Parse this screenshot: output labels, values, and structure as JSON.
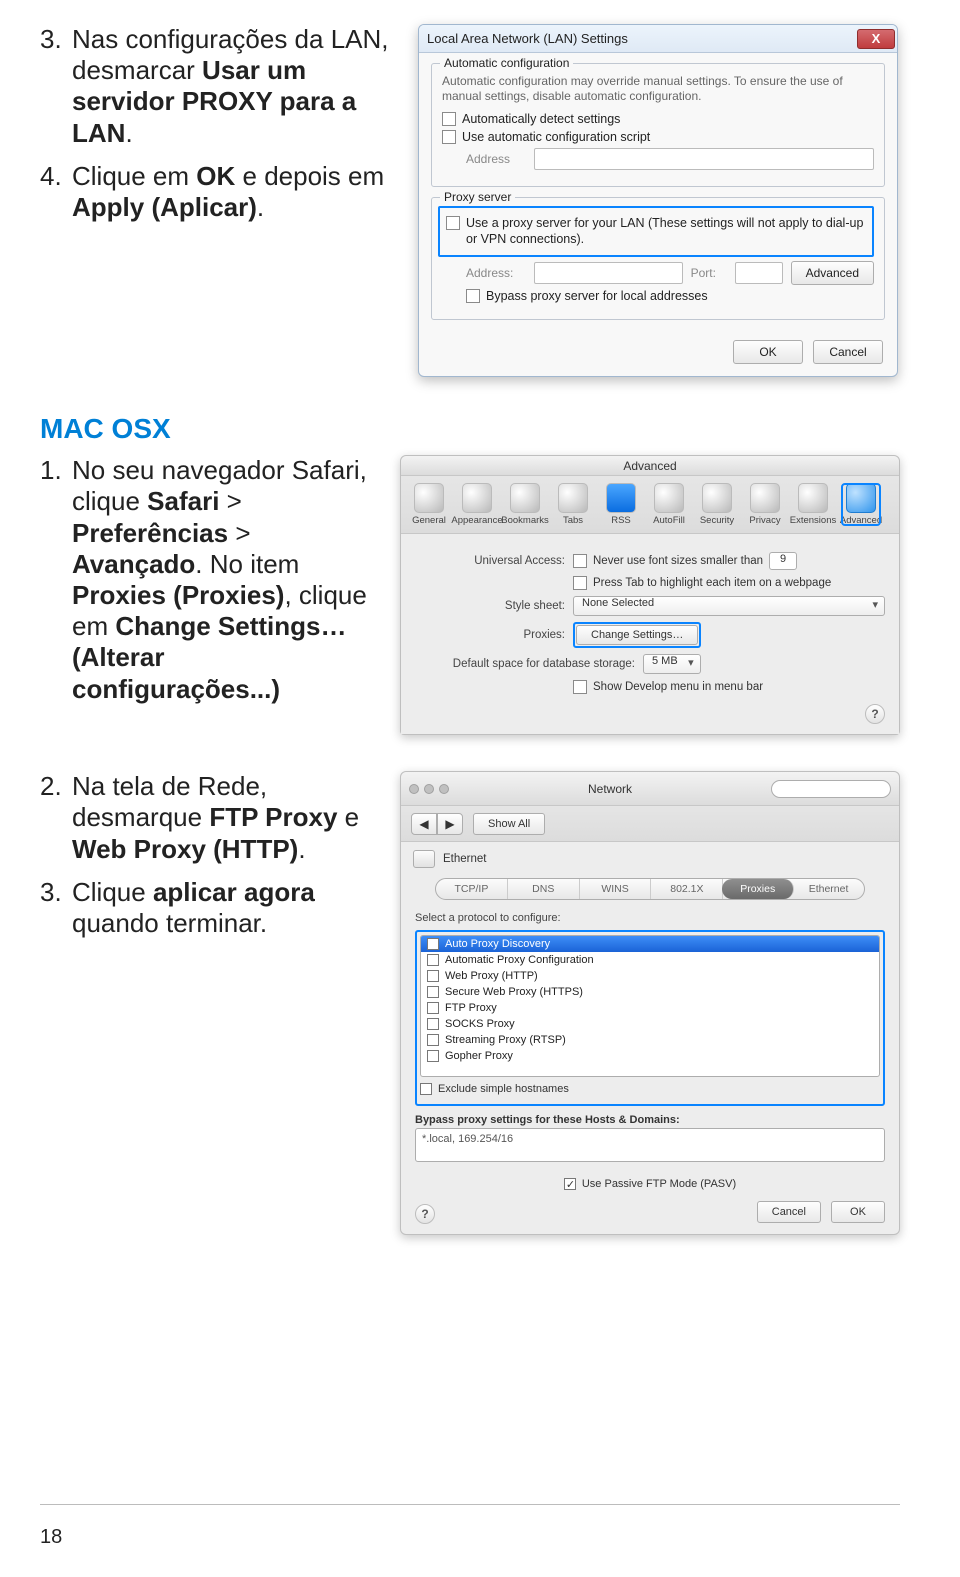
{
  "step3": {
    "num": "3.",
    "pre": "Nas configurações da LAN, desmarcar ",
    "bold1": "Usar um servidor PROXY para a LAN",
    "post": "."
  },
  "step4": {
    "num": "4.",
    "pre": "Clique em ",
    "bold1": "OK",
    "mid": " e depois em ",
    "bold2": "Apply (Aplicar)",
    "post": "."
  },
  "lan": {
    "title": "Local Area Network (LAN) Settings",
    "grp_auto": "Automatic configuration",
    "hint_auto": "Automatic configuration may override manual settings. To ensure the use of manual settings, disable automatic configuration.",
    "chk_detect": "Automatically detect settings",
    "chk_script": "Use automatic configuration script",
    "lbl_address": "Address",
    "grp_proxy": "Proxy server",
    "chk_proxy": "Use a proxy server for your LAN (These settings will not apply to dial-up or VPN connections).",
    "lbl_addr2": "Address:",
    "lbl_port": "Port:",
    "btn_adv": "Advanced",
    "chk_bypass": "Bypass proxy server for local addresses",
    "btn_ok": "OK",
    "btn_cancel": "Cancel"
  },
  "mac_heading": "MAC OSX",
  "mac1": {
    "num": "1.",
    "pre": "No seu navegador Safari, clique ",
    "bold1": "Safari",
    "mid1": " > ",
    "bold2": "Preferências",
    "mid2": " > ",
    "bold3": "Avançado",
    "mid3": ". No item ",
    "bold4": "Proxies (Proxies)",
    "mid4": ", clique em ",
    "bold5": "Change Settings… (Alterar configurações...)"
  },
  "adv": {
    "title": "Advanced",
    "tools": [
      "General",
      "Appearance",
      "Bookmarks",
      "Tabs",
      "RSS",
      "AutoFill",
      "Security",
      "Privacy",
      "Extensions",
      "Advanced"
    ],
    "ua_label": "Universal Access:",
    "ua_chk": "Never use font sizes smaller than",
    "ua_val": "9",
    "tab_chk": "Press Tab to highlight each item on a webpage",
    "style_label": "Style sheet:",
    "style_val": "None Selected",
    "proxies_label": "Proxies:",
    "proxies_btn": "Change Settings…",
    "db_label": "Default space for database storage:",
    "db_val": "5 MB",
    "dev_chk": "Show Develop menu in menu bar"
  },
  "mac2": {
    "num": "2.",
    "pre": "Na tela de Rede, desmarque ",
    "bold1": "FTP Proxy",
    "mid": " e ",
    "bold2": "Web Proxy (HTTP)",
    "post": "."
  },
  "mac3": {
    "num": "3.",
    "pre": "Clique ",
    "bold1": "aplicar agora",
    "post": " quando terminar."
  },
  "net": {
    "win_title": "Network",
    "back_lbl": "Show All",
    "iface": "Ethernet",
    "tabs": [
      "TCP/IP",
      "DNS",
      "WINS",
      "802.1X",
      "Proxies",
      "Ethernet"
    ],
    "sel_label": "Select a protocol to configure:",
    "items": [
      "Auto Proxy Discovery",
      "Automatic Proxy Configuration",
      "Web Proxy (HTTP)",
      "Secure Web Proxy (HTTPS)",
      "FTP Proxy",
      "SOCKS Proxy",
      "Streaming Proxy (RTSP)",
      "Gopher Proxy"
    ],
    "exclude": "Exclude simple hostnames",
    "bypass_lbl": "Bypass proxy settings for these Hosts & Domains:",
    "bypass_val": "*.local, 169.254/16",
    "passive": "Use Passive FTP Mode (PASV)",
    "btn_cancel": "Cancel",
    "btn_ok": "OK"
  },
  "page_number": "18"
}
